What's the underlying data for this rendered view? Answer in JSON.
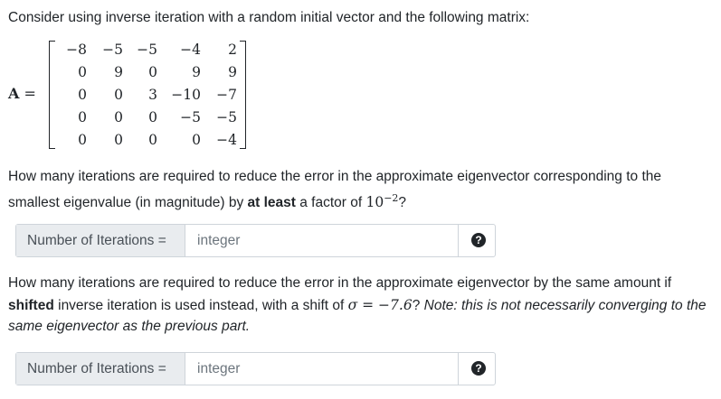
{
  "intro": "Consider using inverse iteration with a random initial vector and the following matrix:",
  "matrix": {
    "name": "A",
    "equals": "=",
    "rows": [
      [
        "−8",
        "−5",
        "−5",
        "−4",
        "2"
      ],
      [
        "0",
        "9",
        "0",
        "9",
        "9"
      ],
      [
        "0",
        "0",
        "3",
        "−10",
        "−7"
      ],
      [
        "0",
        "0",
        "0",
        "−5",
        "−5"
      ],
      [
        "0",
        "0",
        "0",
        "0",
        "−4"
      ]
    ]
  },
  "q1": {
    "line1": "How many iterations are required to reduce the error in the approximate eigenvector corresponding to the",
    "line2_pre": "smallest eigenvalue (in magnitude) by ",
    "line2_bold": "at least",
    "line2_mid": " a factor of ",
    "power_base": "10",
    "power_exp": "−2",
    "line2_end": "?",
    "field_label": "Number of Iterations =",
    "placeholder": "integer"
  },
  "q2": {
    "line1": "How many iterations are required to reduce the error in the approximate eigenvector by the same amount if",
    "line2_bold": "shifted",
    "line2_pre": " inverse iteration is used instead, with a shift of ",
    "sigma": "σ = −7.6",
    "line2_mid": "? ",
    "note_part1": "Note: this is not necessarily converging to the",
    "note_part2": "same eigenvector as the previous part.",
    "field_label": "Number of Iterations =",
    "placeholder": "integer"
  },
  "help_glyph": "?"
}
